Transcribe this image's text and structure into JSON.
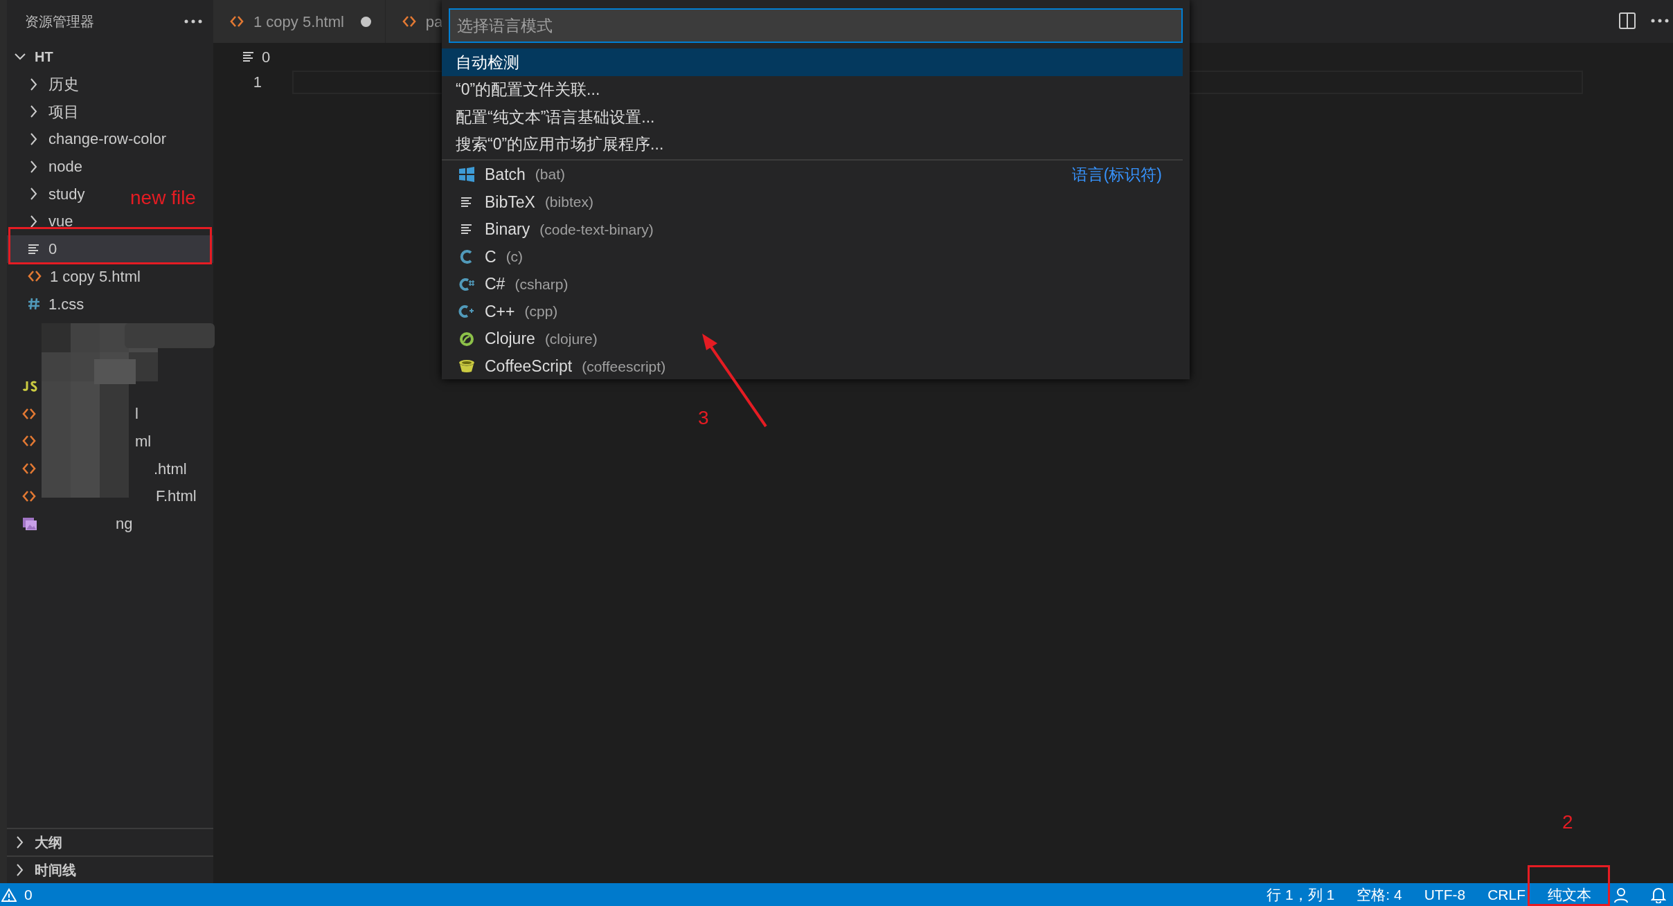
{
  "sidebar": {
    "title": "资源管理器",
    "folder": {
      "label": "HT",
      "expanded": true,
      "children": [
        {
          "kind": "folder",
          "label": "历史",
          "expanded": false,
          "selected": false
        },
        {
          "kind": "folder",
          "label": "项目",
          "expanded": false,
          "selected": false
        },
        {
          "kind": "folder",
          "label": "change-row-color",
          "expanded": false,
          "selected": false
        },
        {
          "kind": "folder",
          "label": "node",
          "expanded": false,
          "selected": false
        },
        {
          "kind": "folder",
          "label": "study",
          "expanded": false,
          "selected": false
        },
        {
          "kind": "folder",
          "label": "vue",
          "expanded": false,
          "selected": false
        },
        {
          "kind": "text",
          "label": "0",
          "selected": true
        },
        {
          "kind": "html",
          "label": "1 copy 5.html",
          "selected": false
        },
        {
          "kind": "css",
          "label": "1.css",
          "selected": false
        }
      ]
    },
    "obscured_items": [
      {
        "kind": "blank"
      },
      {
        "kind": "blank"
      },
      {
        "kind": "js"
      },
      {
        "kind": "html",
        "label": "l"
      },
      {
        "kind": "html",
        "label": "ml"
      },
      {
        "kind": "html",
        "label": ".html"
      },
      {
        "kind": "html",
        "label": "F.html"
      },
      {
        "kind": "image",
        "label": "ng"
      }
    ],
    "panels": [
      {
        "label": "大纲",
        "expanded": false
      },
      {
        "label": "时间线",
        "expanded": false
      }
    ]
  },
  "tabs": [
    {
      "kind": "html",
      "label": "1 copy 5.html",
      "dirty": true
    },
    {
      "kind": "html",
      "label": "pa"
    }
  ],
  "editor": {
    "breadcrumb": "0",
    "line_numbers": [
      "1"
    ]
  },
  "quick_pick": {
    "placeholder": "选择语言模式",
    "actions": [
      {
        "label": "自动检测",
        "selected": true
      },
      {
        "label": "“0”的配置文件关联...",
        "selected": false
      },
      {
        "label": "配置“纯文本”语言基础设置...",
        "selected": false
      },
      {
        "label": "搜索“0”的应用市场扩展程序...",
        "selected": false
      }
    ],
    "languages": [
      {
        "kind": "windows",
        "name": "Batch",
        "id": "(bat)",
        "hint": "语言(标识符)",
        "selected": false
      },
      {
        "kind": "lines",
        "name": "BibTeX",
        "id": "(bibtex)",
        "selected": false
      },
      {
        "kind": "lines",
        "name": "Binary",
        "id": "(code-text-binary)",
        "selected": false
      },
      {
        "kind": "c",
        "name": "C",
        "id": "(c)",
        "selected": false
      },
      {
        "kind": "csharp",
        "name": "C#",
        "id": "(csharp)",
        "selected": false
      },
      {
        "kind": "cpp",
        "name": "C++",
        "id": "(cpp)",
        "selected": false
      },
      {
        "kind": "clojure",
        "name": "Clojure",
        "id": "(clojure)",
        "selected": false
      },
      {
        "kind": "coffee",
        "name": "CoffeeScript",
        "id": "(coffeescript)",
        "selected": false
      }
    ]
  },
  "status_bar": {
    "problems": "0",
    "items": [
      "行 1，列 1",
      "空格: 4",
      "UTF-8",
      "CRLF",
      "纯文本"
    ]
  },
  "annotations": [
    {
      "kind": "box"
    },
    {
      "kind": "label",
      "text": "new file"
    },
    {
      "kind": "label",
      "text": "3"
    },
    {
      "kind": "arrow"
    },
    {
      "kind": "label",
      "text": "2"
    },
    {
      "kind": "box"
    }
  ]
}
